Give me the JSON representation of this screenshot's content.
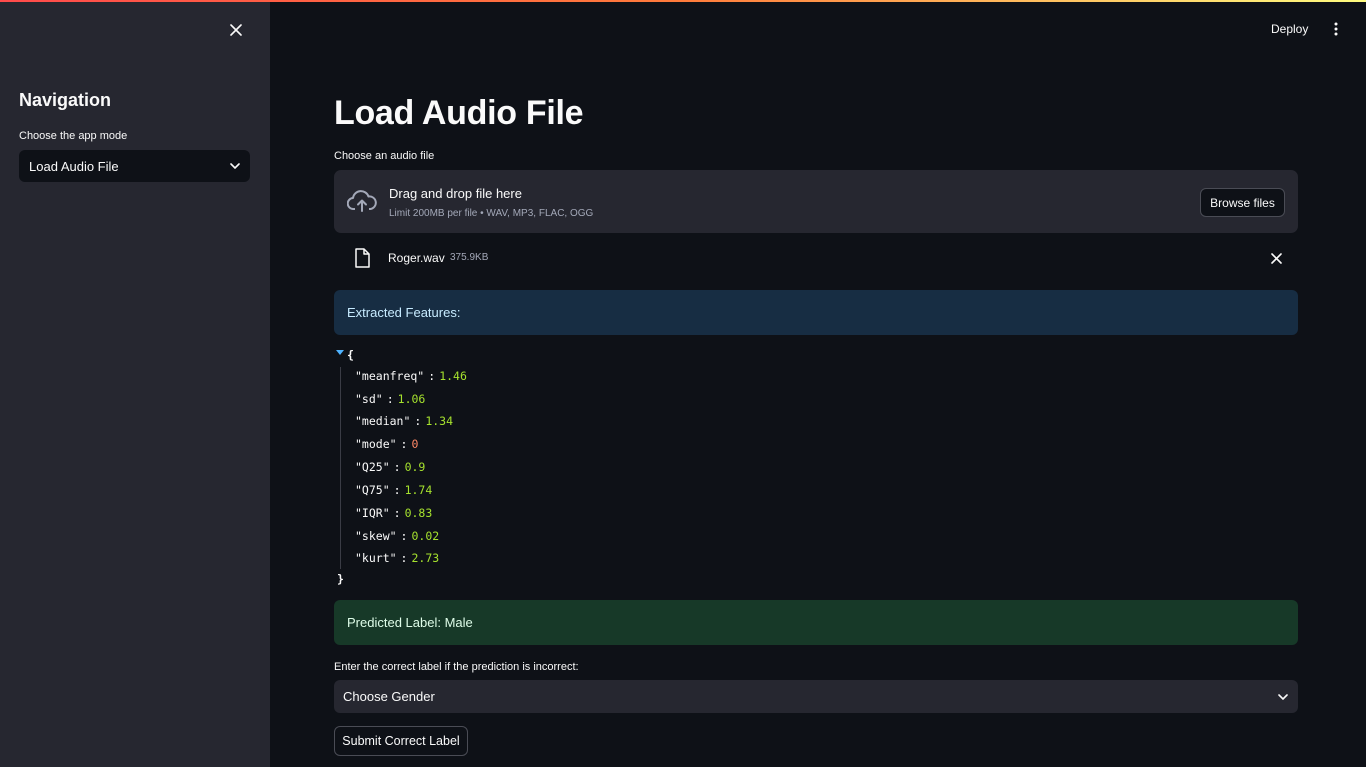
{
  "header": {
    "deploy_label": "Deploy",
    "menu_icon": "vertical-ellipsis-icon"
  },
  "sidebar": {
    "close_icon": "close-icon",
    "heading": "Navigation",
    "mode_label": "Choose the app mode",
    "mode_selected": "Load Audio File"
  },
  "main": {
    "title": "Load Audio File",
    "uploader": {
      "label": "Choose an audio file",
      "drop_text": "Drag and drop file here",
      "limit_text": "Limit 200MB per file • WAV, MP3, FLAC, OGG",
      "browse_label": "Browse files"
    },
    "file": {
      "name": "Roger.wav",
      "size": "375.9KB"
    },
    "info_text": "Extracted Features:",
    "features_open": "{",
    "features_close": "}",
    "features": [
      {
        "key": "\"meanfreq\"",
        "value": "1.46"
      },
      {
        "key": "\"sd\"",
        "value": "1.06"
      },
      {
        "key": "\"median\"",
        "value": "1.34"
      },
      {
        "key": "\"mode\"",
        "value": "0"
      },
      {
        "key": "\"Q25\"",
        "value": "0.9"
      },
      {
        "key": "\"Q75\"",
        "value": "1.74"
      },
      {
        "key": "\"IQR\"",
        "value": "0.83"
      },
      {
        "key": "\"skew\"",
        "value": "0.02"
      },
      {
        "key": "\"kurt\"",
        "value": "2.73"
      }
    ],
    "prediction_text": "Predicted Label: Male",
    "correct_label_prompt": "Enter the correct label if the prediction is incorrect:",
    "gender_placeholder": "Choose Gender",
    "submit_label": "Submit Correct Label"
  },
  "colors": {
    "background": "#0e1117",
    "sidebar": "#262730",
    "info_bg": "#172d43",
    "success_bg": "#173928",
    "number": "#a6e22e",
    "zero": "#ff8866"
  }
}
